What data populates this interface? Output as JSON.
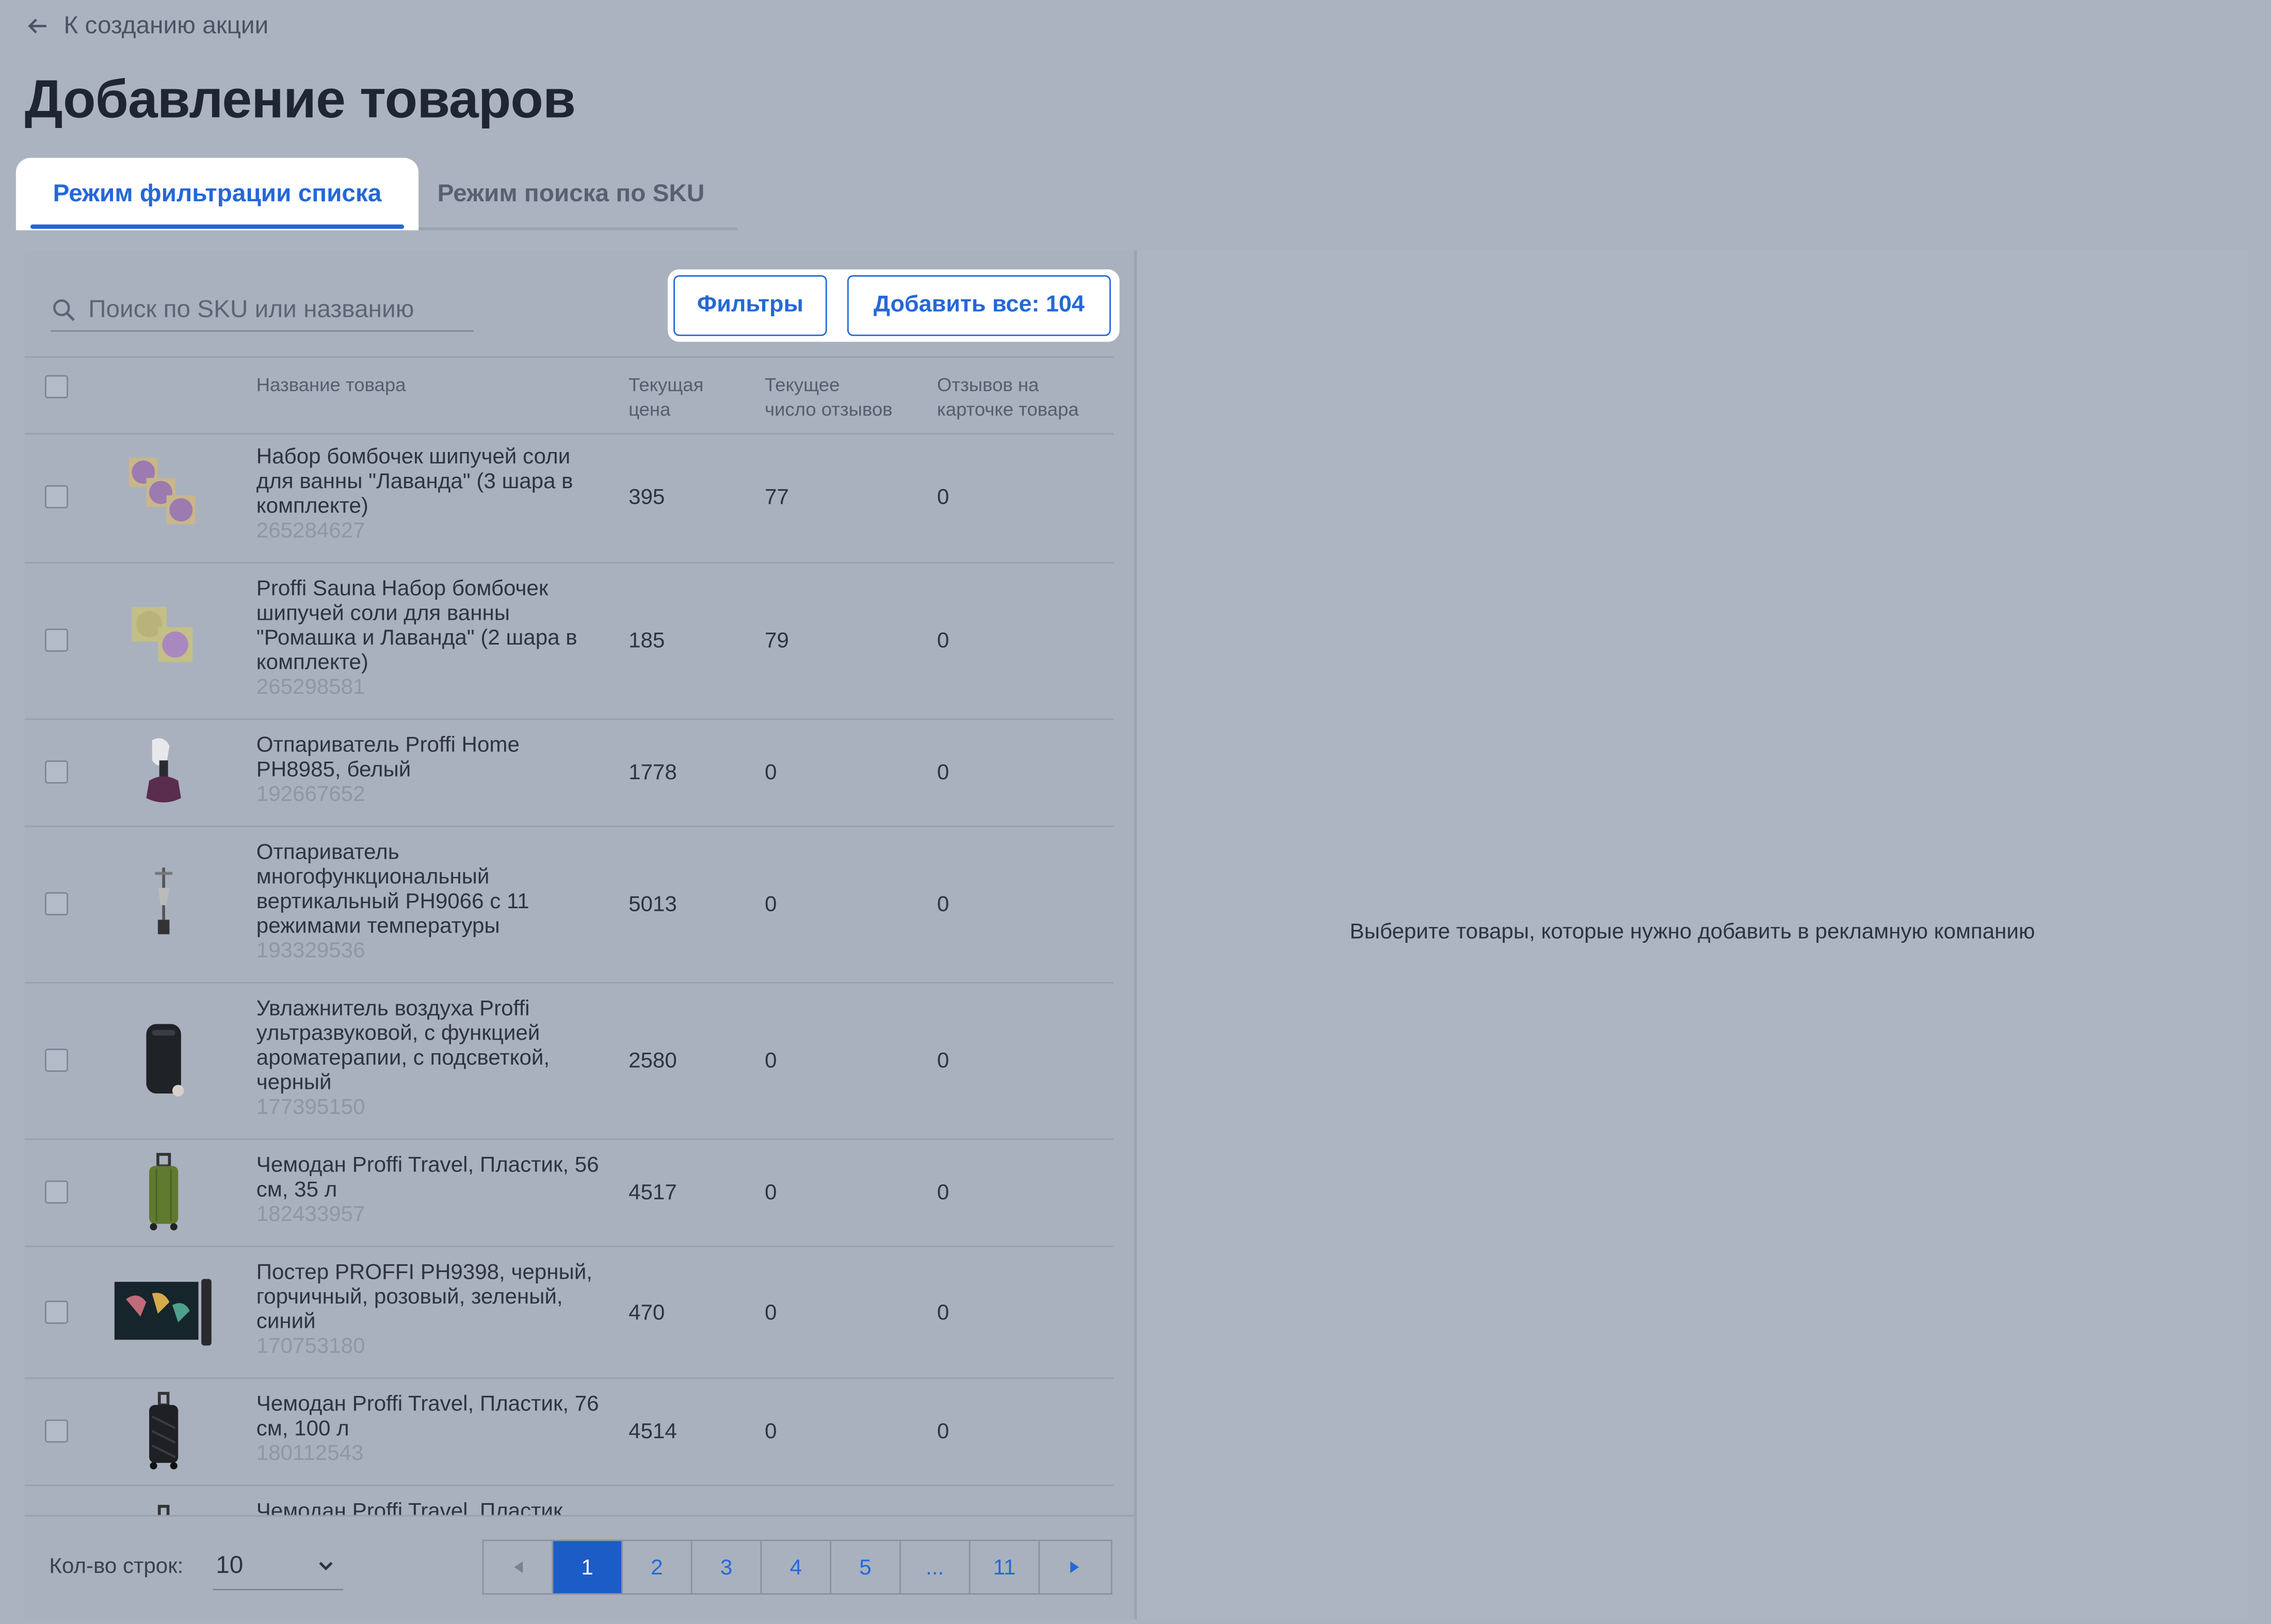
{
  "back_link": "К созданию акции",
  "title": "Добавление товаров",
  "tabs": [
    {
      "label": "Режим фильтрации списка",
      "active": true
    },
    {
      "label": "Режим поиска по SKU",
      "active": false
    }
  ],
  "search": {
    "placeholder": "Поиск по SKU или названию",
    "value": ""
  },
  "buttons": {
    "filters": "Фильтры",
    "add_all": "Добавить все: 104"
  },
  "table": {
    "headers": {
      "name": "Название товара",
      "price_line1": "Текущая",
      "price_line2": "цена",
      "reviews_line1": "Текущее",
      "reviews_line2": "число отзывов",
      "card_line1": "Отзывов на",
      "card_line2": "карточке товара"
    },
    "rows": [
      {
        "name": "Набор бомбочек шипучей соли для ванны \"Лаванда\" (3 шара в комплекте)",
        "sku": "265284627",
        "price": "395",
        "reviews": "77",
        "card_reviews": "0"
      },
      {
        "name": "Proffi Sauna Набор бомбочек шипучей соли для ванны \"Ромашка и Лаванда\" (2 шара в комплекте)",
        "sku": "265298581",
        "price": "185",
        "reviews": "79",
        "card_reviews": "0"
      },
      {
        "name": "Отпариватель Proffi Home PH8985, белый",
        "sku": "192667652",
        "price": "1778",
        "reviews": "0",
        "card_reviews": "0"
      },
      {
        "name": "Отпариватель многофункциональный вертикальный PH9066 с 11 режимами температуры",
        "sku": "193329536",
        "price": "5013",
        "reviews": "0",
        "card_reviews": "0"
      },
      {
        "name": "Увлажнитель воздуха Proffi ультразвуковой, с функцией ароматерапии, с подсветкой, черный",
        "sku": "177395150",
        "price": "2580",
        "reviews": "0",
        "card_reviews": "0"
      },
      {
        "name": "Чемодан Proffi Travel, Пластик, 56 см, 35 л",
        "sku": "182433957",
        "price": "4517",
        "reviews": "0",
        "card_reviews": "0"
      },
      {
        "name": "Постер PROFFI PH9398, черный, горчичный, розовый, зеленый, синий",
        "sku": "170753180",
        "price": "470",
        "reviews": "0",
        "card_reviews": "0"
      },
      {
        "name": "Чемодан Proffi Travel, Пластик, 76 см, 100 л",
        "sku": "180112543",
        "price": "4514",
        "reviews": "0",
        "card_reviews": "0"
      },
      {
        "name": "Чемодан Proffi Travel, Пластик",
        "sku": "",
        "price": "",
        "reviews": "",
        "card_reviews": ""
      }
    ]
  },
  "footer": {
    "rows_label": "Кол-во строк:",
    "rows_value": "10",
    "pages": [
      "1",
      "2",
      "3",
      "4",
      "5",
      "...",
      "11"
    ],
    "current_page": "1"
  },
  "right_panel": {
    "message": "Выберите товары, которые нужно добавить в рекламную компанию"
  },
  "colors": {
    "accent": "#2468d8",
    "background": "#abb3c0",
    "white": "#ffffff"
  },
  "icons": [
    "arrow-left-icon",
    "search-icon",
    "chevron-down-icon",
    "triangle-left-icon",
    "triangle-right-icon"
  ]
}
